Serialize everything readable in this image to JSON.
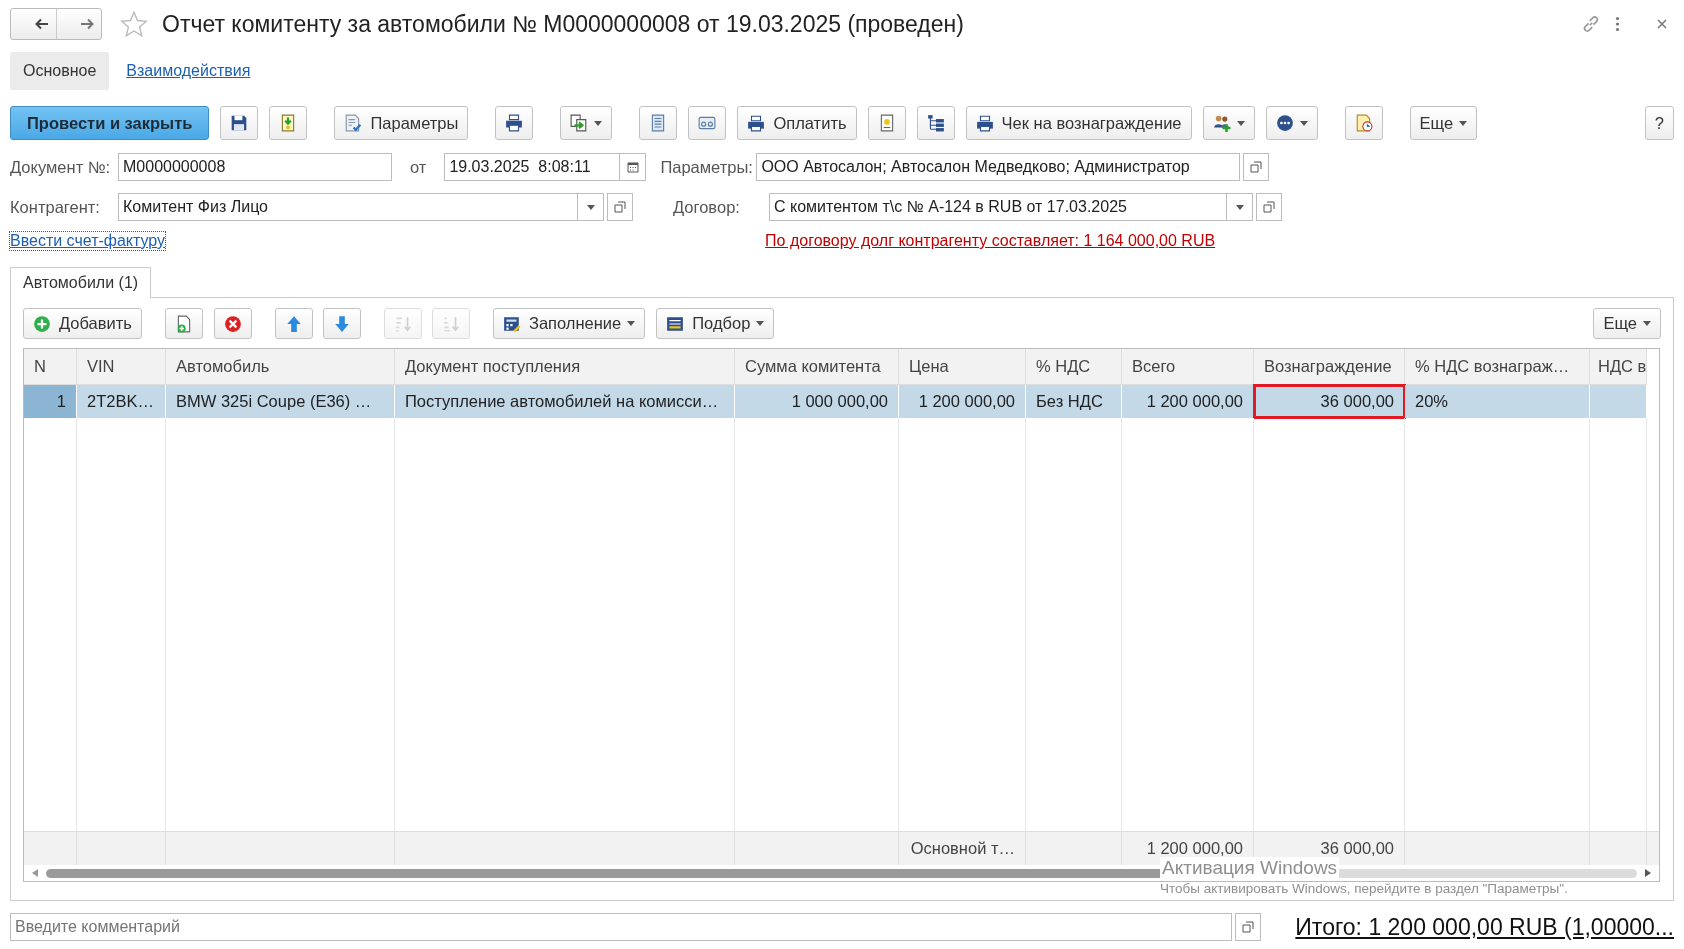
{
  "window": {
    "title": "Отчет комитенту за автомобили № М0000000008 от 19.03.2025 (проведен)",
    "favorite": false
  },
  "tabs": [
    {
      "label": "Основное",
      "selected": true
    },
    {
      "label": "Взаимодействия",
      "selected": false
    }
  ],
  "toolbar": [
    {
      "kind": "primary",
      "label": "Провести и закрыть"
    },
    {
      "kind": "icon"
    },
    {
      "kind": "icon"
    },
    {
      "kind": "icon_text",
      "label": "Параметры"
    },
    {
      "kind": "icon"
    },
    {
      "kind": "icon_menu"
    },
    {
      "kind": "icon"
    },
    {
      "kind": "icon"
    },
    {
      "kind": "icon_text",
      "label": "Оплатить"
    },
    {
      "kind": "icon"
    },
    {
      "kind": "icon"
    },
    {
      "kind": "icon_text",
      "label": "Чек на вознаграждение"
    },
    {
      "kind": "icon_menu"
    },
    {
      "kind": "icon_menu"
    },
    {
      "kind": "icon"
    },
    {
      "kind": "menu",
      "label": "Еще"
    },
    {
      "kind": "text",
      "label": "?"
    }
  ],
  "header_fields": {
    "document_number": {
      "label": "Документ №:",
      "value": "М0000000008"
    },
    "date": {
      "label": "от",
      "value": "19.03.2025  8:08:11"
    },
    "parameters": {
      "label": "Параметры:",
      "value": "ООО Автосалон; Автосалон Медведково; Администратор"
    },
    "counterparty": {
      "label": "Контрагент:",
      "value": "Комитент Физ Лицо"
    },
    "contract": {
      "label": "Договор:",
      "value": "С комитентом т\\с № А-124 в RUB от 17.03.2025"
    }
  },
  "invoice_link": "Ввести счет-фактуру",
  "debt_warning": "По договору долг контрагенту составляет: 1 164 000,00 RUB",
  "table_tabs": [
    {
      "label": "Автомобили (1)",
      "selected": true
    }
  ],
  "table_toolbar": [
    {
      "kind": "icon_text",
      "label": "Добавить",
      "disabled": false
    },
    {
      "kind": "icon",
      "disabled": false
    },
    {
      "kind": "icon",
      "disabled": false
    },
    {
      "kind": "icon",
      "disabled": false
    },
    {
      "kind": "icon",
      "disabled": false
    },
    {
      "kind": "icon",
      "disabled": true
    },
    {
      "kind": "icon",
      "disabled": true
    },
    {
      "kind": "icon_menu_text",
      "label": "Заполнение",
      "disabled": false
    },
    {
      "kind": "icon_menu_text",
      "label": "Подбор",
      "disabled": false
    },
    {
      "kind": "menu",
      "label": "Еще",
      "disabled": false
    }
  ],
  "table": {
    "columns": [
      "N",
      "VIN",
      "Автомобиль",
      "Документ поступления",
      "Сумма комитента",
      "Цена",
      "% НДС",
      "Всего",
      "Вознаграждение",
      "% НДС вознаграж…",
      "НДС в"
    ],
    "rows": [
      {
        "selected": true,
        "cells": [
          {
            "text": "1",
            "outlined": false
          },
          {
            "text": "2T2BK…",
            "outlined": false
          },
          {
            "text": "BMW 325i Coupe (E36) …",
            "outlined": false
          },
          {
            "text": "Поступление автомобилей на комисси…",
            "outlined": false
          },
          {
            "text": "1 000 000,00",
            "outlined": false
          },
          {
            "text": "1 200 000,00",
            "outlined": false
          },
          {
            "text": "Без НДС",
            "outlined": false
          },
          {
            "text": "1 200 000,00",
            "outlined": false
          },
          {
            "text": "36 000,00",
            "outlined": true
          },
          {
            "text": "20%",
            "outlined": false
          }
        ]
      }
    ],
    "totals": [
      {
        "text": "Основной т…"
      },
      {
        "text": "1 200 000,00"
      },
      {
        "text": "36 000,00"
      }
    ]
  },
  "comment": {
    "placeholder": "Введите комментарий"
  },
  "total_link": "Итого: 1 200 000,00 RUB (1,00000...",
  "os_overlay": {
    "title": "Активация Windows",
    "text": "Чтобы активировать Windows, перейдите в раздел \"Параметры\"."
  }
}
